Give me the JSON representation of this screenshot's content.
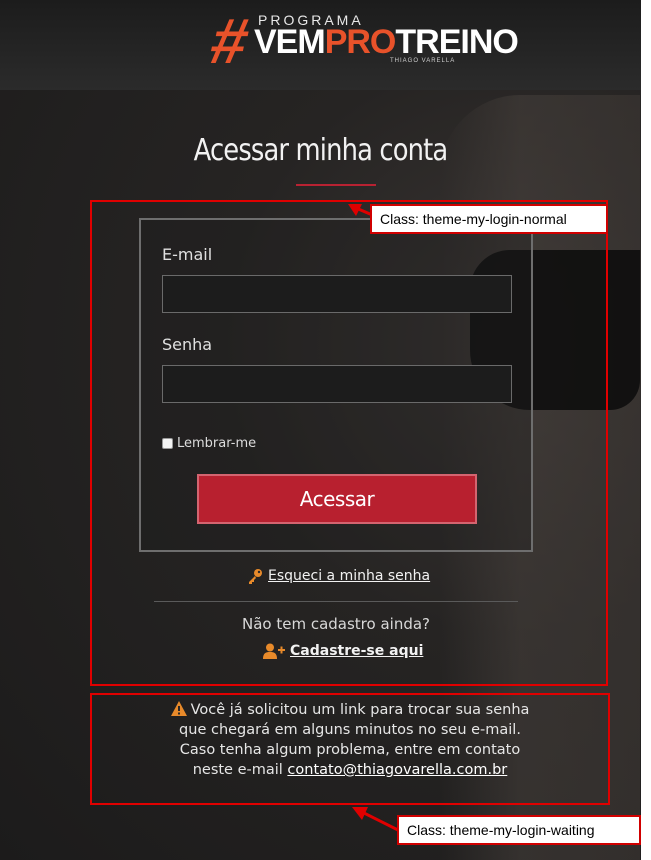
{
  "header": {
    "logo_hash": "#",
    "logo_programa": "PROGRAMA",
    "logo_vem": "VEM",
    "logo_pro": "PRO",
    "logo_treino": "TREINO",
    "logo_sub": "THIAGO VARELLA"
  },
  "page_title": "Acessar minha conta",
  "form": {
    "email_label": "E-mail",
    "email_value": "",
    "password_label": "Senha",
    "password_value": "",
    "remember_label": "Lembrar-me",
    "remember_checked": false,
    "submit_label": "Acessar"
  },
  "links": {
    "forgot_password": "Esqueci a minha senha",
    "no_account": "Não tem cadastro ainda?",
    "signup": "Cadastre-se aqui"
  },
  "waiting_message": {
    "line1": "Você já solicitou um link para trocar sua senha",
    "line2": "que chegará em alguns minutos no seu e-mail.",
    "line3": "Caso tenha algum problema, entre em contato",
    "line4_prefix": "neste e-mail ",
    "contact_email": "contato@thiagovarella.com.br"
  },
  "annotations": {
    "normal_label": "Class: theme-my-login-normal",
    "waiting_label": "Class: theme-my-login-waiting"
  },
  "colors": {
    "accent_red": "#b8202f",
    "logo_orange": "#e8522a",
    "annotation_red": "#e00000",
    "icon_orange": "#e88a2a"
  },
  "icons": {
    "forgot": "key-icon",
    "signup": "user-plus-icon",
    "warning": "warning-icon"
  }
}
